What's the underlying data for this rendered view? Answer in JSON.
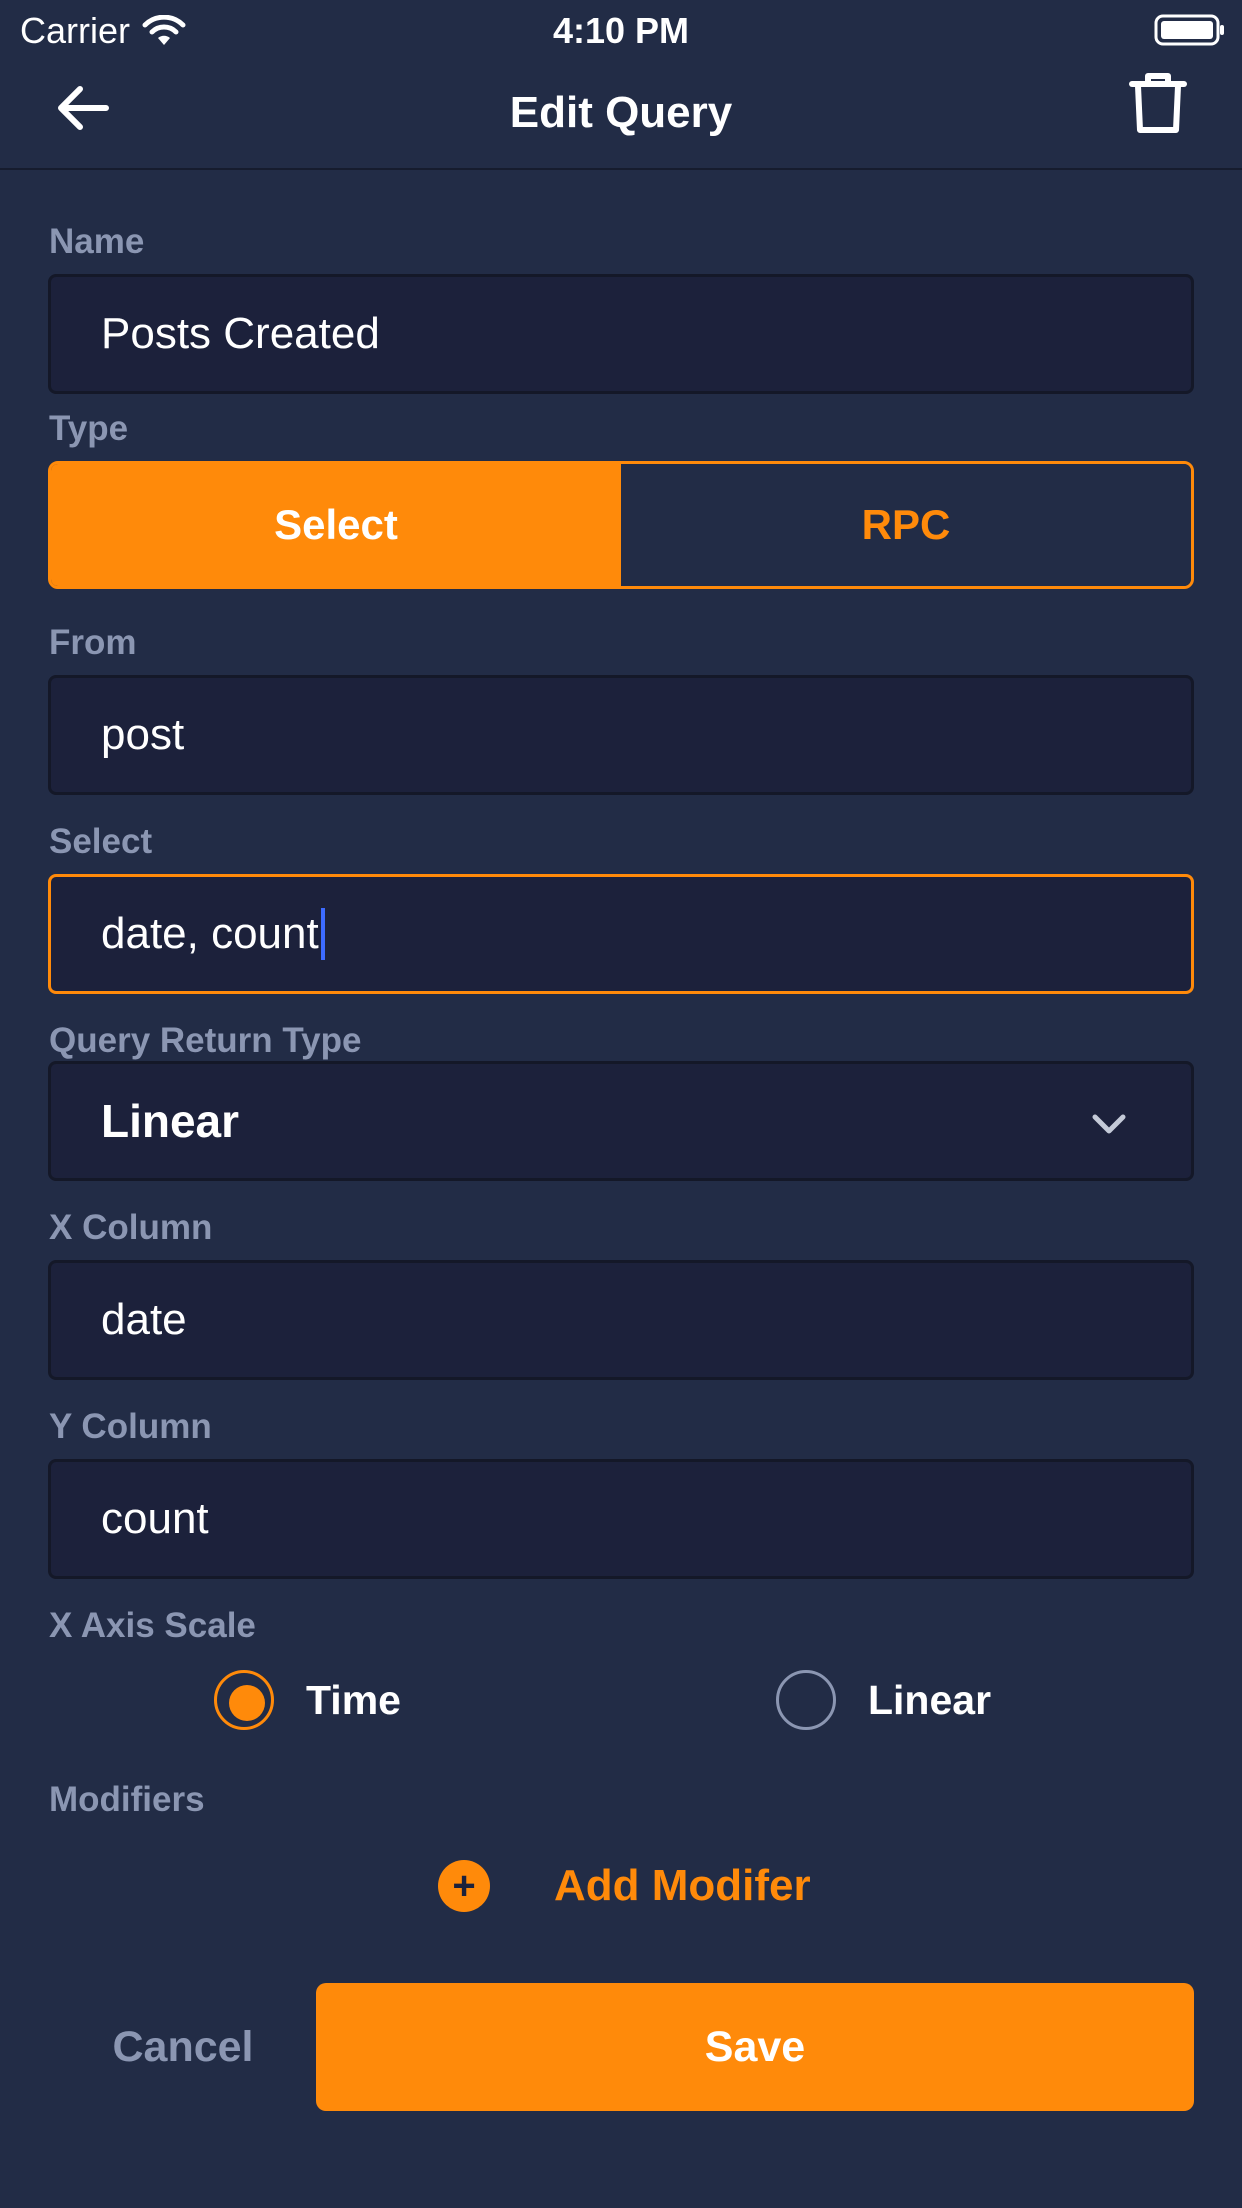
{
  "status_bar": {
    "carrier": "Carrier",
    "time": "4:10 PM",
    "wifi_icon": "wifi-icon",
    "battery_icon": "battery-icon"
  },
  "nav": {
    "title": "Edit Query",
    "back_icon": "arrow-left-icon",
    "delete_icon": "trash-icon"
  },
  "form": {
    "name_label": "Name",
    "name_value": "Posts Created",
    "type_label": "Type",
    "type_options": [
      "Select",
      "RPC"
    ],
    "type_selected": "Select",
    "from_label": "From",
    "from_value": "post",
    "select_label": "Select",
    "select_value": "date, count",
    "return_type_label": "Query Return Type",
    "return_type_value": "Linear",
    "x_column_label": "X Column",
    "x_column_value": "date",
    "y_column_label": "Y Column",
    "y_column_value": "count",
    "x_axis_scale_label": "X Axis Scale",
    "x_axis_scale_options": [
      "Time",
      "Linear"
    ],
    "x_axis_scale_selected": "Time",
    "modifiers_label": "Modifiers",
    "add_modifier_label": "Add Modifer"
  },
  "actions": {
    "cancel_label": "Cancel",
    "save_label": "Save"
  },
  "colors": {
    "background": "#222c46",
    "field": "#1c213b",
    "accent": "#ff8a0a",
    "muted": "#8b96b2",
    "caret": "#3d6bff"
  }
}
